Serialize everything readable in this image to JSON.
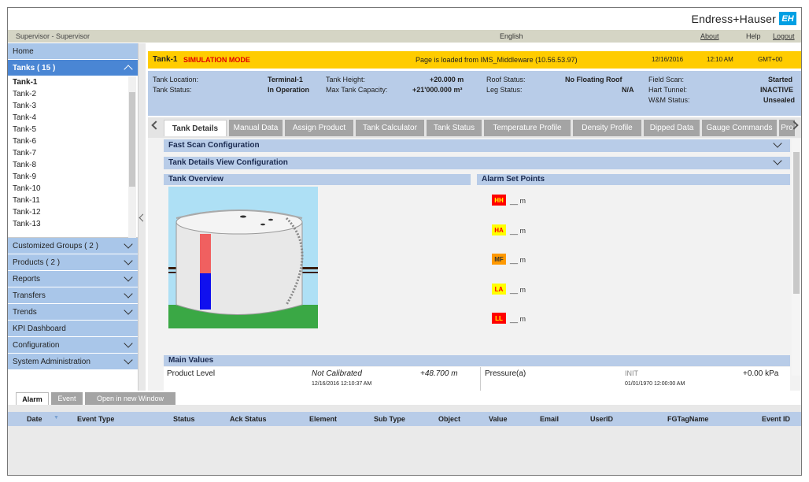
{
  "brand": {
    "name": "Endress+Hauser",
    "logo": "EH"
  },
  "userbar": {
    "user": "Supervisor - Supervisor",
    "language": "English",
    "about": "About",
    "help": "Help",
    "logout": "Logout"
  },
  "sidebar": {
    "home": "Home",
    "tanks_header": "Tanks ( 15 )",
    "tanks": [
      "Tank-1",
      "Tank-2",
      "Tank-3",
      "Tank-4",
      "Tank-5",
      "Tank-6",
      "Tank-7",
      "Tank-8",
      "Tank-9",
      "Tank-10",
      "Tank-11",
      "Tank-12",
      "Tank-13"
    ],
    "sections": [
      "Customized Groups ( 2 )",
      "Products ( 2 )",
      "Reports",
      "Transfers",
      "Trends",
      "KPI Dashboard",
      "Configuration",
      "System Administration"
    ]
  },
  "simbar": {
    "tank": "Tank-1",
    "mode": "SIMULATION MODE",
    "loaded": "Page is loaded from IMS_Middleware (10.56.53.97)",
    "date": "12/16/2016",
    "time": "12:10 AM",
    "tz": "GMT+00"
  },
  "info": {
    "location_label": "Tank Location:",
    "location_value": "Terminal-1",
    "status_label": "Tank Status:",
    "status_value": "In Operation",
    "height_label": "Tank Height:",
    "height_value": "+20.000 m",
    "capacity_label": "Max Tank Capacity:",
    "capacity_value": "+21'000.000 m³",
    "roof_label": "Roof Status:",
    "roof_value": "No Floating Roof",
    "leg_label": "Leg Status:",
    "leg_value": "N/A",
    "fieldscan_label": "Field Scan:",
    "fieldscan_value": "Started",
    "hart_label": "Hart Tunnel:",
    "hart_value": "INACTIVE",
    "wm_label": "W&M Status:",
    "wm_value": "Unsealed"
  },
  "tabs": [
    "Tank Details",
    "Manual Data",
    "Assign Product",
    "Tank Calculator",
    "Tank Status",
    "Temperature Profile",
    "Density Profile",
    "Dipped Data",
    "Gauge Commands",
    "Pro"
  ],
  "content": {
    "fast_scan": "Fast Scan Configuration",
    "view_config": "Tank Details View Configuration",
    "overview": "Tank Overview",
    "alarm_setpoints": "Alarm Set Points",
    "alarms": [
      {
        "code": "HH",
        "value": "__ m",
        "bg": "#ff0000",
        "fg": "#ffff00"
      },
      {
        "code": "HA",
        "value": "__ m",
        "bg": "#ffff00",
        "fg": "#ff0000"
      },
      {
        "code": "MF",
        "value": "__ m",
        "bg": "#ff9900",
        "fg": "#333333"
      },
      {
        "code": "LA",
        "value": "__ m",
        "bg": "#ffff00",
        "fg": "#ff0000"
      },
      {
        "code": "LL",
        "value": "__ m",
        "bg": "#ff0000",
        "fg": "#ffff00"
      }
    ],
    "main_values": "Main Values",
    "product_level_label": "Product Level",
    "product_level_status": "Not Calibrated",
    "product_level_value": "+48.700 m",
    "product_level_time": "12/16/2016 12:10:37 AM",
    "pressure_label": "Pressure(a)",
    "pressure_status": "INIT",
    "pressure_value": "+0.00 kPa",
    "pressure_time": "01/01/1970 12:00:00 AM"
  },
  "bottom_tabs": [
    "Alarm",
    "Event",
    "Open in new Window"
  ],
  "alarm_columns": [
    "Date",
    "Event Type",
    "Status",
    "Ack Status",
    "Element",
    "Sub Type",
    "Object",
    "Value",
    "Email",
    "UserID",
    "FGTagName",
    "Event ID"
  ]
}
